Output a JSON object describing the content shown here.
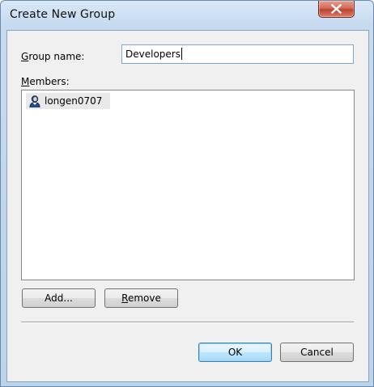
{
  "window": {
    "title": "Create New Group",
    "close_icon": "close-icon"
  },
  "form": {
    "group_name_label_prefix": "",
    "group_name_label_accel": "G",
    "group_name_label_rest": "roup name:",
    "group_name_value": "Developers",
    "members_label_accel": "M",
    "members_label_rest": "embers:"
  },
  "members": [
    {
      "name": "longen0707",
      "icon": "user-icon"
    }
  ],
  "buttons": {
    "add": "Add...",
    "remove_accel": "R",
    "remove_rest": "emove",
    "ok": "OK",
    "cancel": "Cancel"
  },
  "colors": {
    "title_bar": "#c6daf0",
    "close_button": "#c0402e",
    "dialog_body": "#f0f0f0",
    "default_button_border": "#3c7fb1"
  }
}
